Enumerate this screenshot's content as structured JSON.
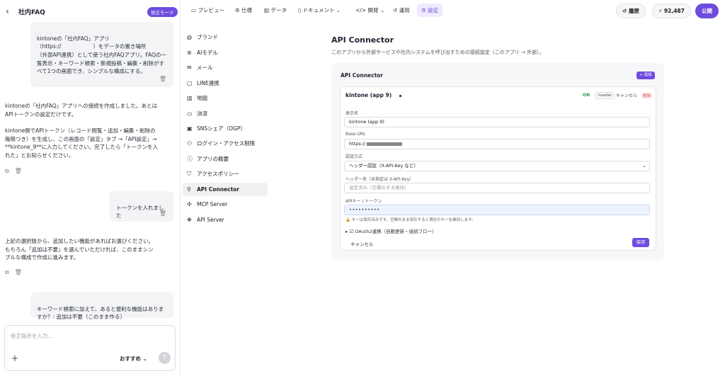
{
  "chat": {
    "title": "社内FAQ",
    "mode_badge": "修正モード",
    "messages": [
      {
        "role": "user",
        "text": "kintoneの「社内FAQ」アプリ\n（https://　　　　　　）をデータの置き場所\n（外部API連携）として使う社内FAQアプリ。FAQの一\n覧表示・キーワード検索・新規投稿・編集・削除がす\nべて1つの画面でき、シンプルな構成にする。"
      },
      {
        "role": "assistant",
        "text": "kintoneの「社内FAQ」アプリへの接続を作成しました。あとは\nAPIトークンの設定だけです。\n\nkintone側でAPIトークン（レコード閲覧・追加・編集・削除の\n権限つき）を生成し、この画面の「設定」タブ →「API設定」→\n**kintone_9**に入力してください。完了したら「トークンを入\nれた」とお知らせください。"
      },
      {
        "role": "user",
        "text": "トークンを入れました"
      },
      {
        "role": "assistant",
        "text": "上記の選択肢から、追加したい機能があればお選びください。\nもちろん「追加は不要」を選んでいただければ、このままシン\nプルな構成で作成に進みます。"
      },
      {
        "role": "user",
        "text": "キーワード検索に加えて、あると便利な機能はありま\nすか？: 追加は不要（このまま作る）"
      }
    ],
    "composer": {
      "placeholder": "修正指示を入力...",
      "model_label": "おすすめ"
    }
  },
  "topnav": {
    "items": [
      "プレビュー",
      "仕様",
      "データ",
      "ドキュメント",
      "開発",
      "運用",
      "設定"
    ],
    "active": "設定",
    "history_label": "履歴",
    "credits": "92,487",
    "publish_label": "公開"
  },
  "sidebar": {
    "items": [
      "ブランド",
      "AIモデル",
      "メール",
      "LINE連携",
      "地図",
      "決済",
      "SNSシェア（OGP）",
      "ログイン・アクセス制限",
      "アプリの概要",
      "アクセスポリシー",
      "API Connector",
      "MCP Server",
      "API Server"
    ],
    "active": "API Connector"
  },
  "main": {
    "title": "API Connector",
    "description": "このアプリから外部サービスや社内システムを呼び出すための接続設定（このアプリ → 外部）。",
    "card_title": "API Connector",
    "add_label": "+ 追加",
    "connector": {
      "name": "kintone (app 9)",
      "status": "ON",
      "auth_tag": "header",
      "cancel_label": "キャンセル",
      "delete_label": "削除",
      "display_name_label": "表示名",
      "display_name_value": "kintone (app 9)",
      "base_url_label": "Base URL",
      "base_url_value": "https://",
      "auth_method_label": "認証方式",
      "auth_method_value": "ヘッダー認証（X-API-Key など）",
      "header_name_label": "ヘッダー名（未指定は X-API-Key）",
      "header_name_placeholder": "設定済み（空欄のまま維持）",
      "api_key_label": "APIキー / トークン",
      "api_key_value": "••••••••••",
      "hint": "キーは保存済みです。空欄のまま保存すると現在のキーを維持します。",
      "oauth_label": "OAuth2連携（自動更新・接続フロー）",
      "cancel_link": "キャンセル",
      "save_label": "保存"
    }
  }
}
